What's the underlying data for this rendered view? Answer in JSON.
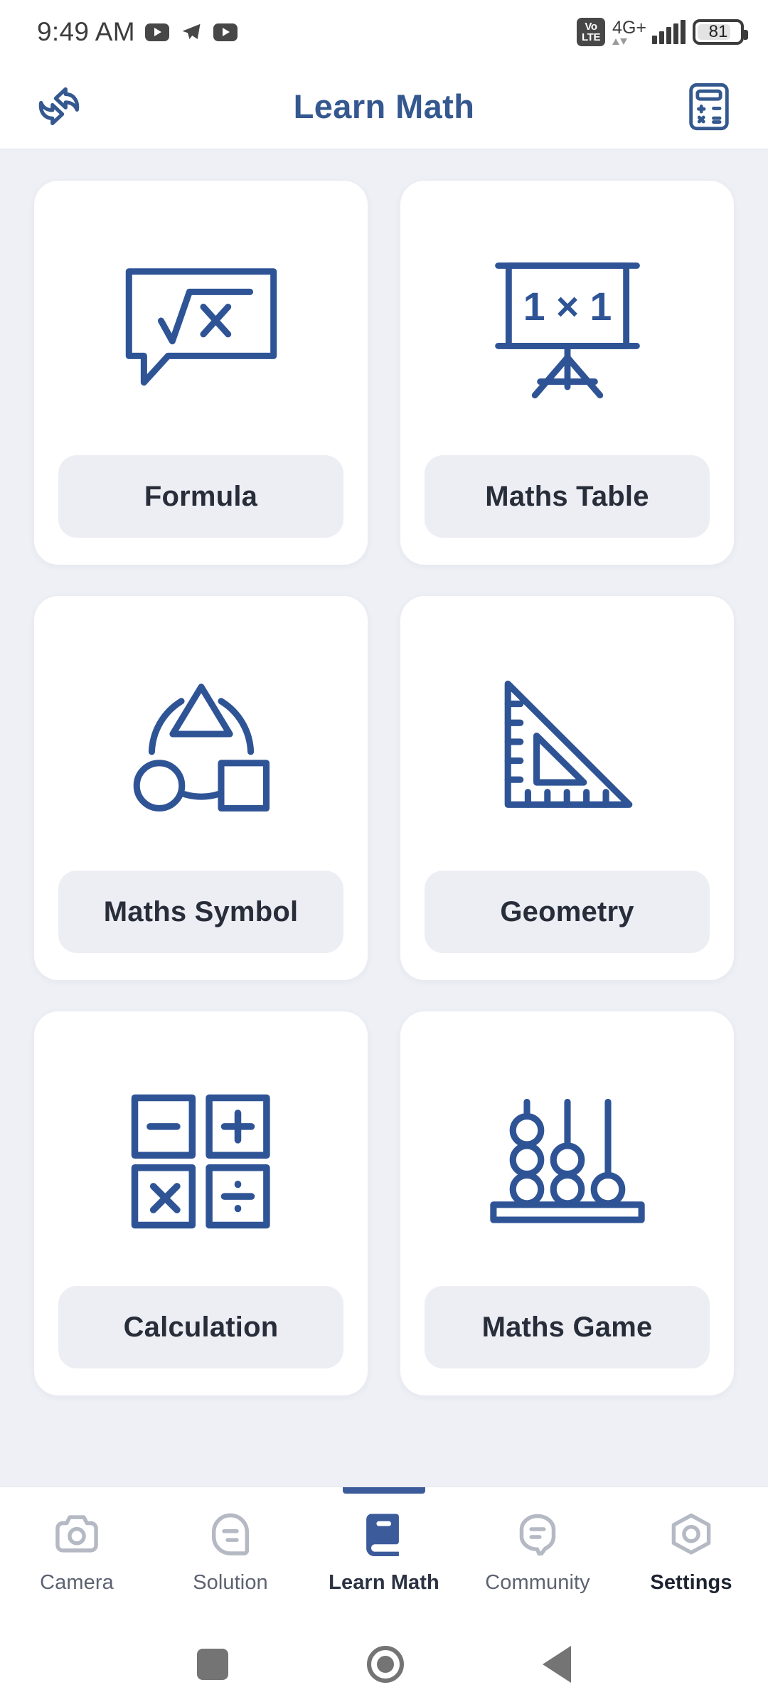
{
  "status_bar": {
    "time": "9:49 AM",
    "left_icons": [
      "youtube-icon",
      "telegram-icon",
      "youtube-icon"
    ],
    "volte_line1": "Vo",
    "volte_line2": "LTE",
    "network": "4G+",
    "signal_bars": 5,
    "battery_level": "81"
  },
  "header": {
    "title": "Learn Math",
    "left_icon": "swap-arrows-icon",
    "right_icon": "calculator-icon",
    "title_color": "#34588f"
  },
  "main": {
    "cards": [
      {
        "label": "Formula",
        "icon": "formula-speech-bubble-icon"
      },
      {
        "label": "Maths Table",
        "icon": "presentation-board-icon",
        "board_text": "1 × 1"
      },
      {
        "label": "Maths Symbol",
        "icon": "shapes-cycle-icon"
      },
      {
        "label": "Geometry",
        "icon": "set-square-ruler-icon"
      },
      {
        "label": "Calculation",
        "icon": "operators-grid-icon",
        "operators": [
          "−",
          "+",
          "×",
          "÷"
        ]
      },
      {
        "label": "Maths Game",
        "icon": "abacus-icon",
        "beads": [
          3,
          2,
          1
        ]
      }
    ]
  },
  "bottom_nav": {
    "active": "Learn Math",
    "items": [
      {
        "label": "Camera",
        "icon": "camera-icon"
      },
      {
        "label": "Solution",
        "icon": "solution-bubble-icon"
      },
      {
        "label": "Learn Math",
        "icon": "book-icon"
      },
      {
        "label": "Community",
        "icon": "chat-bubble-icon"
      },
      {
        "label": "Settings",
        "icon": "hex-gear-icon"
      }
    ]
  },
  "system_nav": {
    "recents": "recents-button",
    "home": "home-button",
    "back": "back-button"
  },
  "colors": {
    "accent": "#34588f",
    "icon_blue": "#2f5496",
    "page_bg": "#eef0f5",
    "card_bg": "#ffffff",
    "pill_bg": "#eceef4",
    "label_text": "#282d3a",
    "nav_inactive": "#b4b9c4"
  }
}
